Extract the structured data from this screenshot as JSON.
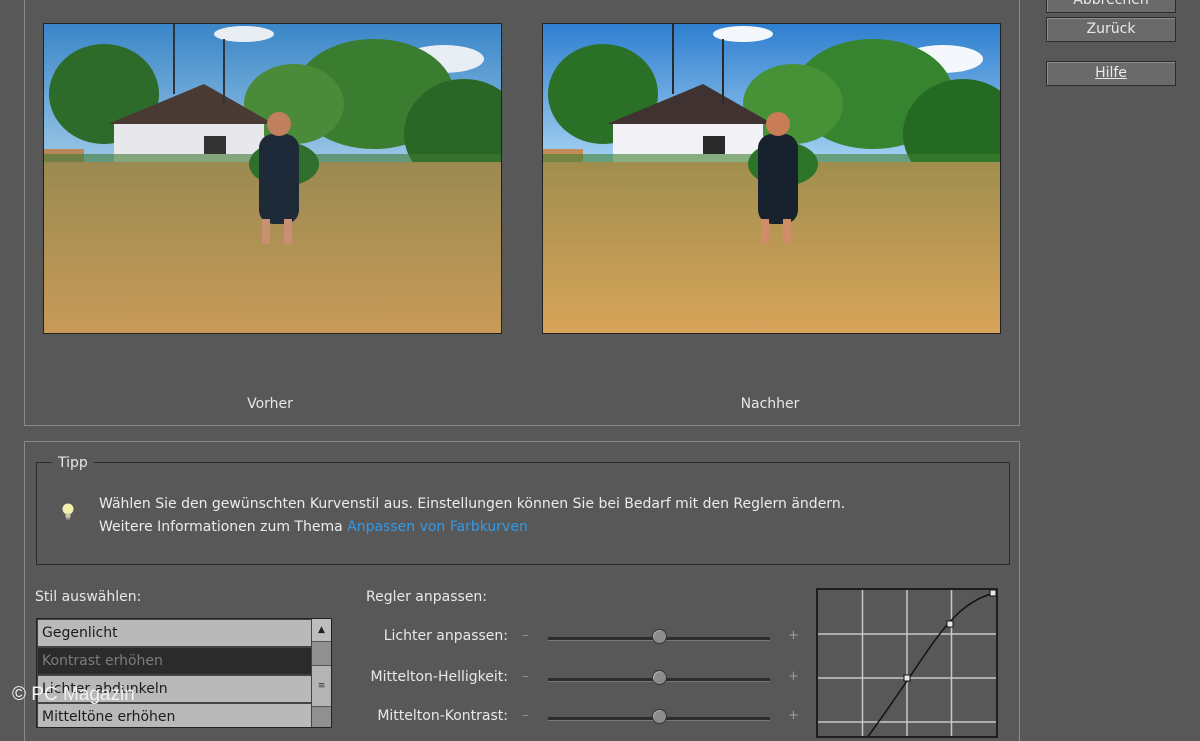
{
  "buttons": {
    "cancel": "Abbrechen",
    "reset": "Zurück",
    "help": "Hilfe"
  },
  "preview": {
    "before_label": "Vorher",
    "after_label": "Nachher"
  },
  "tip": {
    "title": "Tipp",
    "line1": "Wählen Sie den gewünschten Kurvenstil aus. Einstellungen können Sie bei Bedarf mit den Reglern ändern.",
    "line2_prefix": "Weitere Informationen zum Thema ",
    "link": "Anpassen von Farbkurven",
    "icon": "lightbulb-icon"
  },
  "style_select": {
    "label": "Stil auswählen:",
    "items": [
      "Gegenlicht",
      "Kontrast erhöhen",
      "Lichter abdunkeln",
      "Mitteltöne erhöhen"
    ],
    "selected": "Kontrast erhöhen"
  },
  "sliders": {
    "label": "Regler anpassen:",
    "minus": "–",
    "plus": "+",
    "items": [
      {
        "label": "Lichter anpassen:",
        "value": 0.5
      },
      {
        "label": "Mittelton-Helligkeit:",
        "value": 0.5
      },
      {
        "label": "Mittelton-Kontrast:",
        "value": 0.5
      }
    ]
  },
  "watermark": "© PC Magazin",
  "colors": {
    "background": "#585858",
    "link": "#2f9be8",
    "selected_item": "#2b2b2b"
  }
}
